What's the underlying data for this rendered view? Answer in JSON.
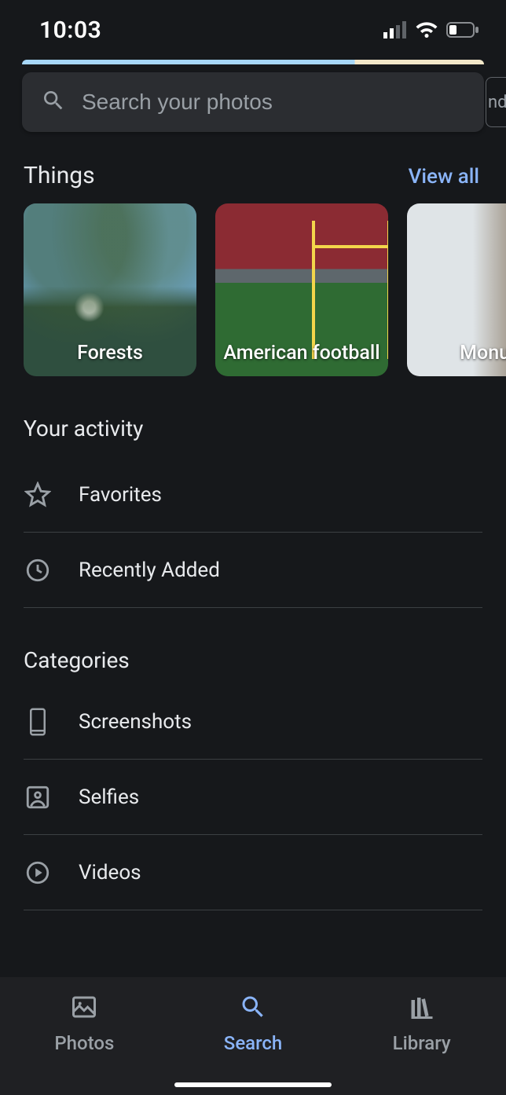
{
  "status": {
    "time": "10:03"
  },
  "search": {
    "placeholder": "Search your photos"
  },
  "side_chip": {
    "text": "nda"
  },
  "things": {
    "title": "Things",
    "view_all": "View all",
    "items": [
      {
        "label": "Forests"
      },
      {
        "label": "American football"
      },
      {
        "label": "Monum"
      }
    ]
  },
  "activity": {
    "title": "Your activity",
    "items": [
      {
        "label": "Favorites",
        "icon": "star-icon"
      },
      {
        "label": "Recently Added",
        "icon": "clock-icon"
      }
    ]
  },
  "categories": {
    "title": "Categories",
    "items": [
      {
        "label": "Screenshots",
        "icon": "smartphone-icon"
      },
      {
        "label": "Selfies",
        "icon": "portrait-icon"
      },
      {
        "label": "Videos",
        "icon": "play-circle-icon"
      }
    ]
  },
  "nav": {
    "items": [
      {
        "label": "Photos",
        "icon": "image-icon"
      },
      {
        "label": "Search",
        "icon": "search-icon"
      },
      {
        "label": "Library",
        "icon": "library-icon"
      }
    ],
    "active": 1
  }
}
